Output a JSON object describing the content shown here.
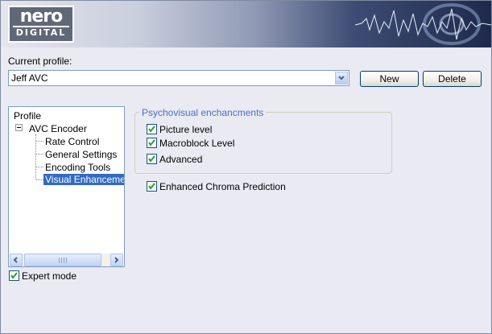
{
  "brand": {
    "logo_word": "nero",
    "logo_sub": "DIGITAL"
  },
  "profile": {
    "label": "Current profile:",
    "selected": "Jeff AVC",
    "new_label": "New",
    "delete_label": "Delete"
  },
  "tree": {
    "root": "Profile",
    "encoder": "AVC Encoder",
    "items": [
      "Rate Control",
      "General Settings",
      "Encoding Tools",
      "Visual Enhancement"
    ],
    "selected_index": 3
  },
  "expert_mode": {
    "label": "Expert mode",
    "checked": true
  },
  "psychovisual": {
    "title": "Psychovisual enchancments",
    "options": [
      {
        "label": "Picture level",
        "checked": true
      },
      {
        "label": "Macroblock Level",
        "checked": true
      },
      {
        "label": "Advanced",
        "checked": true
      }
    ]
  },
  "chroma": {
    "label": "Enhanced Chroma Prediction",
    "checked": true
  },
  "colors": {
    "selection": "#316ac5",
    "group_title": "#4a6fc4",
    "window_bg": "#eaeaf2"
  },
  "icons": [
    "dropdown-arrow-icon",
    "tree-collapse-icon",
    "scroll-left-icon",
    "scroll-right-icon",
    "checkmark-icon"
  ]
}
